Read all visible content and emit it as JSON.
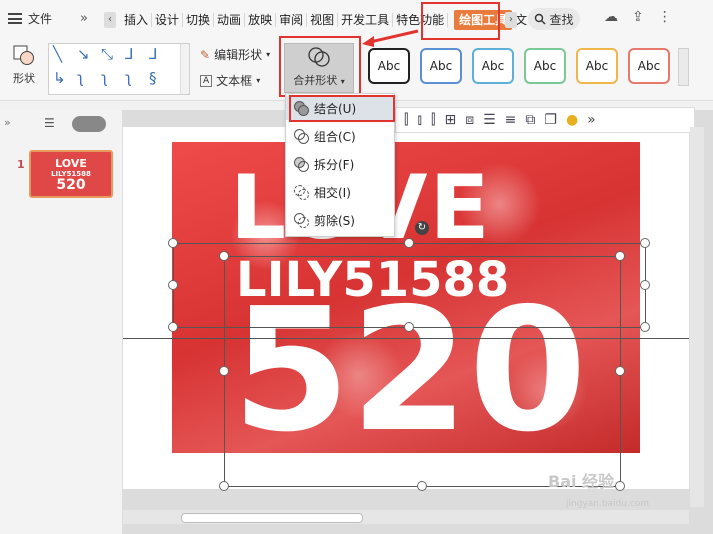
{
  "tabbar": {
    "file_label": "文件",
    "more_label": "»",
    "scroll_left": "‹",
    "scroll_right": "›",
    "tabs": [
      "插入",
      "设计",
      "切换",
      "动画",
      "放映",
      "审阅",
      "视图",
      "开发工具",
      "特色功能",
      "绘图工具",
      "文"
    ],
    "active_tab": "绘图工具",
    "search_label": "查找"
  },
  "ribbon": {
    "shape_label": "形状",
    "edit_shape_label": "编辑形状",
    "text_box_label": "文本框",
    "merge_shape_label": "合并形状",
    "style_samples": [
      "Abc",
      "Abc",
      "Abc",
      "Abc",
      "Abc",
      "Abc"
    ],
    "style_colors": [
      "#222222",
      "#5b8fd4",
      "#5fb0d8",
      "#7cc796",
      "#f0b64a",
      "#e57a6a"
    ]
  },
  "merge_menu": {
    "items": [
      "结合(U)",
      "组合(C)",
      "拆分(F)",
      "相交(I)",
      "剪除(S)"
    ]
  },
  "slides_pane": {
    "slide_number": "1",
    "thumb_line1": "LOVE",
    "thumb_line2": "LILY51588",
    "thumb_line3": "520"
  },
  "slide": {
    "line1": "LOVE",
    "line2": "LILY51588",
    "line3": "520"
  },
  "watermark": {
    "brand": "Bai 经验",
    "url": "jingyan.baidu.com"
  },
  "colors": {
    "accent": "#e87a3b",
    "highlight": "#e2342f",
    "photo_red": "#e04848"
  }
}
